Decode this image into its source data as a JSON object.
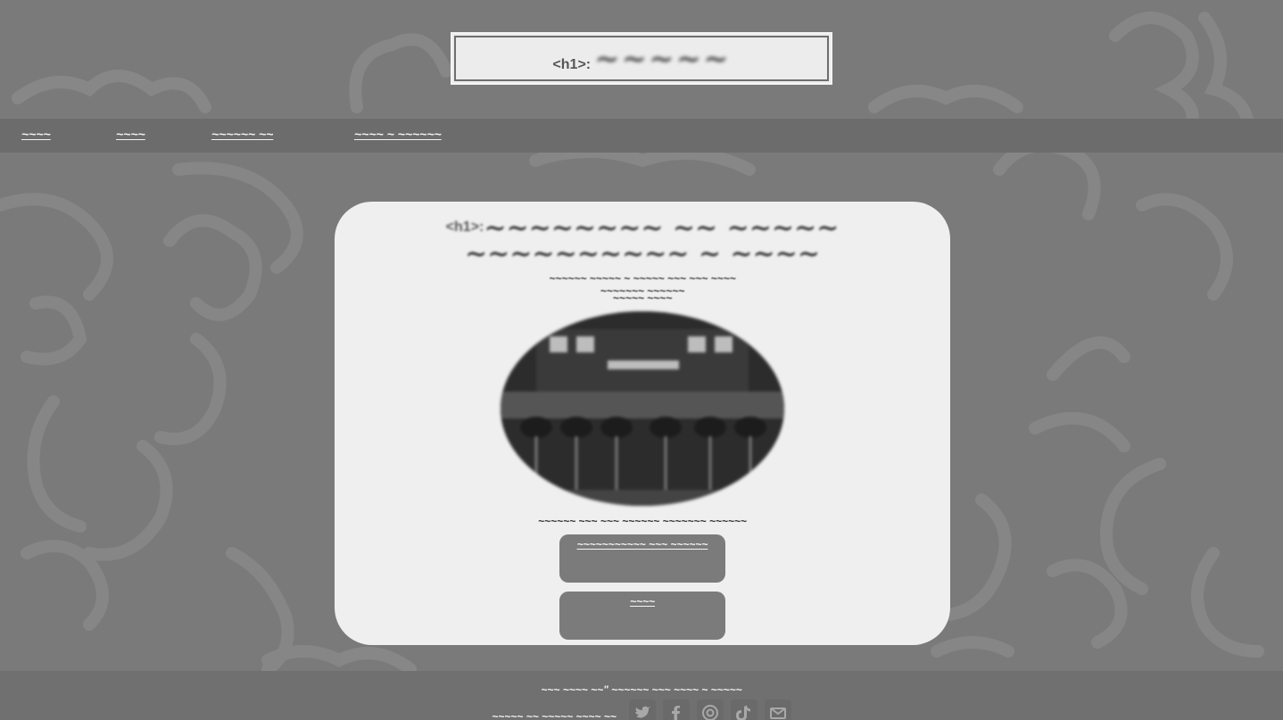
{
  "header": {
    "h1_tag": "<h1>:",
    "title": "~~~~~"
  },
  "nav": {
    "items": [
      {
        "label": "~~~~"
      },
      {
        "label": "~~~~"
      },
      {
        "label": "~~~~~~ ~~"
      },
      {
        "label": "~~~~ ~ ~~~~~~"
      }
    ]
  },
  "card": {
    "h1_tag": "<h1>:",
    "title": "~~~~~~~~ ~~ ~~~~~ ~~~~~~~~~~ ~ ~~~~",
    "subtitle_line1": "~~~~~~ ~~~~~ ~ ~~~~~ ~~~ ~~~ ~~~~",
    "subtitle_line2": "~~~~~~~ ~~~~~~",
    "subtitle_line3": "~~~~~ ~~~~",
    "caption": "~~~~~~ ~~~ ~~~ ~~~~~~ ~~~~~~~ ~~~~~~",
    "button1_label": "~~~~~~~~~~~ ~~~ ~~~~~~",
    "button2_label": "~~~~"
  },
  "footer": {
    "line1": "~~~ ~~~~ ~~\" ~~~~~~ ~~~ ~~~~ ~ ~~~~~",
    "line2": "~~~~~ ~~ ~~~~~ ~~~~ ~~",
    "social_icons": [
      "twitter-icon",
      "facebook-icon",
      "instagram-icon",
      "tiktok-icon",
      "email-icon"
    ]
  },
  "colors": {
    "page_bg": "#7a7a7a",
    "nav_bg": "#6c6c6c",
    "card_bg": "#efefef",
    "button_bg": "#7b7b7b",
    "footer_bg": "#707070"
  }
}
